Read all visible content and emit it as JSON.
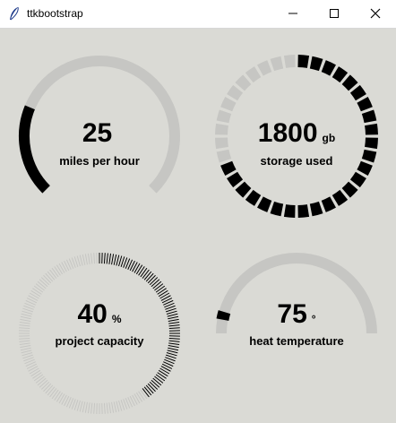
{
  "window": {
    "title": "ttkbootstrap"
  },
  "colors": {
    "track": "#c6c6c3",
    "indicator": "#000000",
    "background": "#dadad5"
  },
  "meters": [
    {
      "id": "speed",
      "value": "25",
      "unit": "",
      "label": "miles per hour",
      "amount": 25,
      "total": 100,
      "arc_start": 135,
      "arc_range": 270,
      "style": "solid"
    },
    {
      "id": "storage",
      "value": "1800",
      "unit": "gb",
      "label": "storage used",
      "amount": 1800,
      "total": 2600,
      "arc_start": -90,
      "arc_range": 360,
      "style": "segmented"
    },
    {
      "id": "capacity",
      "value": "40",
      "unit": "%",
      "label": "project capacity",
      "amount": 40,
      "total": 100,
      "arc_start": -90,
      "arc_range": 360,
      "style": "striped"
    },
    {
      "id": "heat",
      "value": "75",
      "unit": "°",
      "label": "heat temperature",
      "amount": 75,
      "total": 1000,
      "arc_start": 180,
      "arc_range": 180,
      "style": "solid-wedge"
    }
  ]
}
